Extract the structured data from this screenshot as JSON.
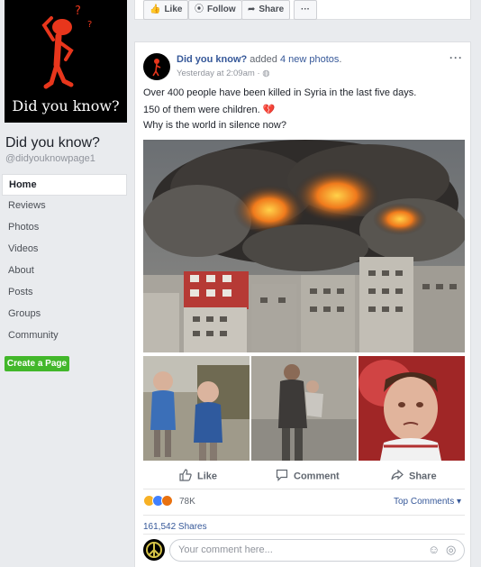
{
  "page": {
    "profile_caption": "Did you know?",
    "name": "Did you know?",
    "handle": "@didyouknowpage1"
  },
  "nav": {
    "items": [
      "Home",
      "Reviews",
      "Photos",
      "Videos",
      "About",
      "Posts",
      "Groups",
      "Community"
    ],
    "active": "Home"
  },
  "create_page_label": "Create a Page",
  "topbar": {
    "like": "Like",
    "follow": "Follow",
    "share": "Share",
    "more": "···"
  },
  "post": {
    "author": "Did you know?",
    "action_prefix": "added",
    "action_link": "4 new photos",
    "action_suffix": ".",
    "time": "Yesterday at 2:09am",
    "privacy_sep": "·",
    "lines": [
      "Over 400 people have been killed in Syria in the last five days.",
      "150 of them were children. 💔",
      "Why is the world in silence now?"
    ],
    "more": "···"
  },
  "actions": {
    "like": "Like",
    "comment": "Comment",
    "share": "Share"
  },
  "stats": {
    "reactions_count": "78K",
    "top_comments": "Top Comments ▾",
    "shares": "161,542 Shares"
  },
  "comment_box": {
    "placeholder": "Your comment here..."
  },
  "colors": {
    "link": "#365899",
    "create_button": "#42b72a",
    "background": "#e9ebee"
  }
}
